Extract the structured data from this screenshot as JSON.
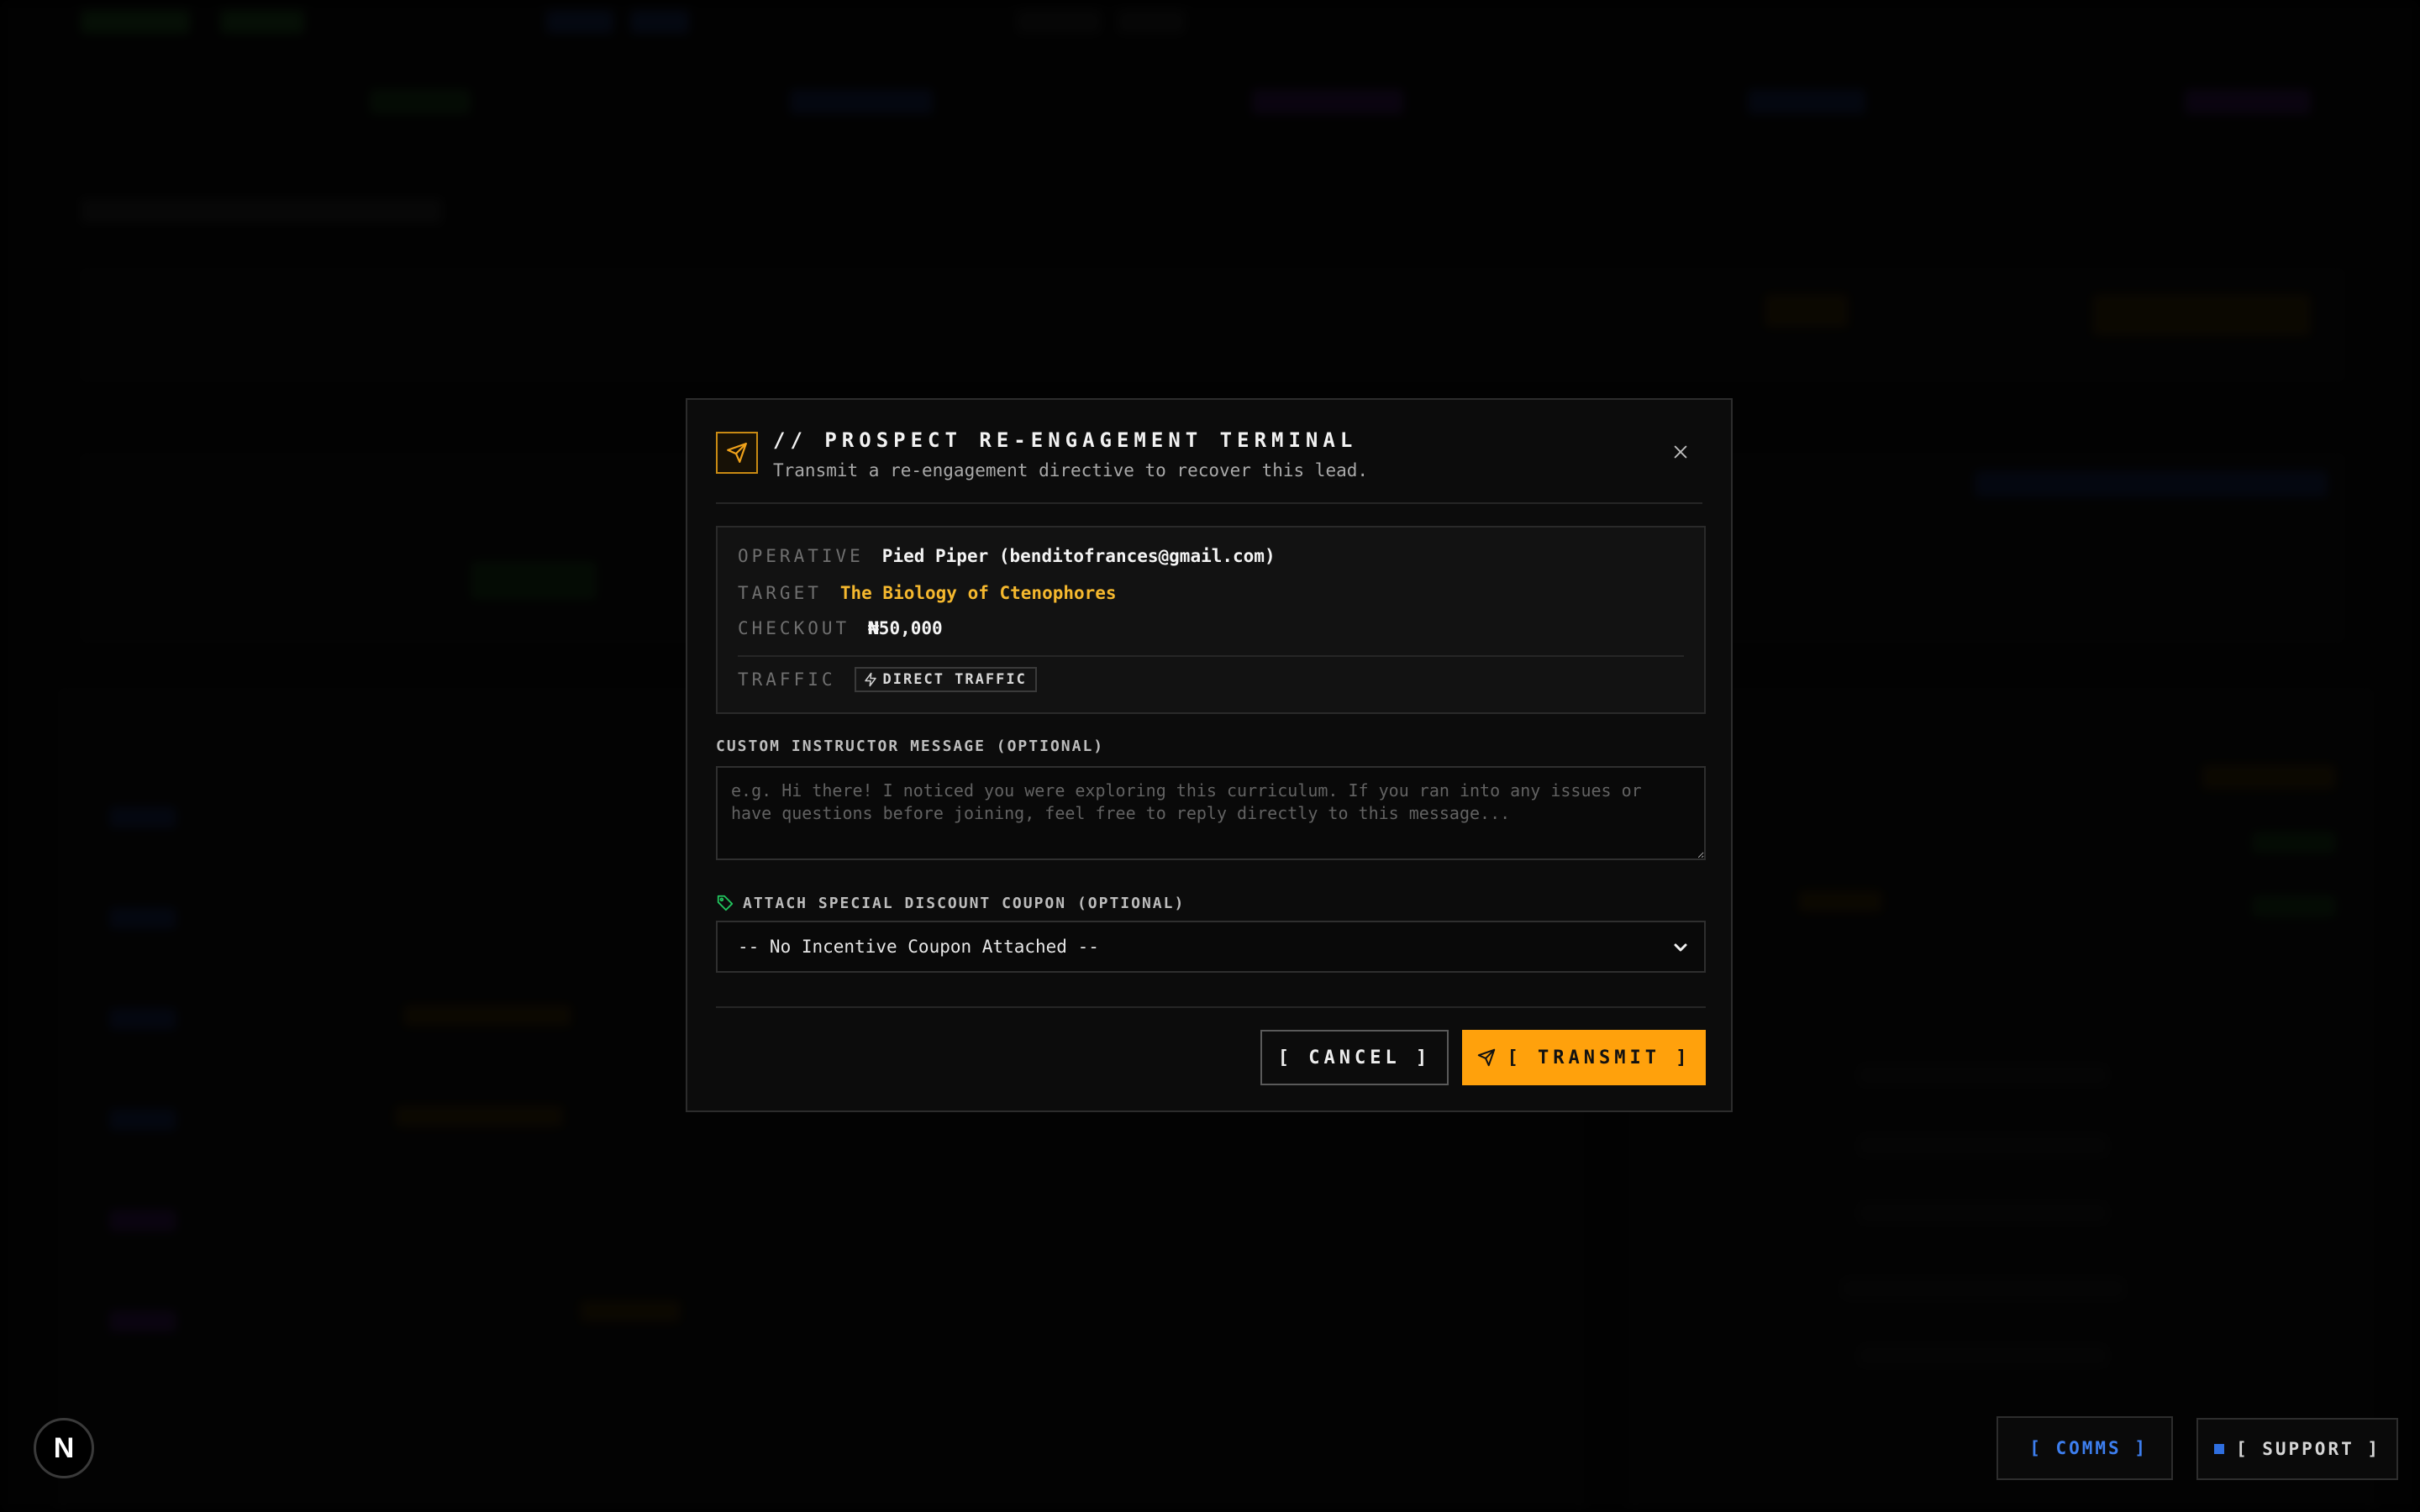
{
  "modal": {
    "title": "// PROSPECT RE-ENGAGEMENT TERMINAL",
    "subtitle": "Transmit a re-engagement directive to recover this lead.",
    "info": {
      "operative_label": "OPERATIVE",
      "operative_value": "Pied Piper (benditofrances@gmail.com)",
      "target_label": "TARGET",
      "target_value": "The Biology of Ctenophores",
      "checkout_label": "CHECKOUT",
      "checkout_value": "₦50,000",
      "traffic_label": "TRAFFIC",
      "traffic_value": "DIRECT TRAFFIC"
    },
    "message": {
      "label": "CUSTOM INSTRUCTOR MESSAGE (OPTIONAL)",
      "placeholder": "e.g. Hi there! I noticed you were exploring this curriculum. If you ran into any issues or have questions before joining, feel free to reply directly to this message...",
      "value": ""
    },
    "coupon": {
      "label": "ATTACH SPECIAL DISCOUNT COUPON (OPTIONAL)",
      "selected": "-- No Incentive Coupon Attached --"
    },
    "buttons": {
      "cancel": "[ CANCEL ]",
      "transmit": "[ TRANSMIT ]"
    }
  },
  "floating": {
    "logo_letter": "N",
    "comms": "[ COMMS ]",
    "support": "[ SUPPORT ]"
  },
  "colors": {
    "accent": "#ffa10c",
    "target_text": "#f5b82e",
    "coupon_icon": "#22c55e",
    "comms_text": "#3d7ff0"
  },
  "icons": {
    "header": "send-icon",
    "close": "close-icon",
    "traffic": "bolt-icon",
    "coupon": "tag-icon",
    "select": "chevron-down-icon",
    "transmit": "send-icon"
  }
}
